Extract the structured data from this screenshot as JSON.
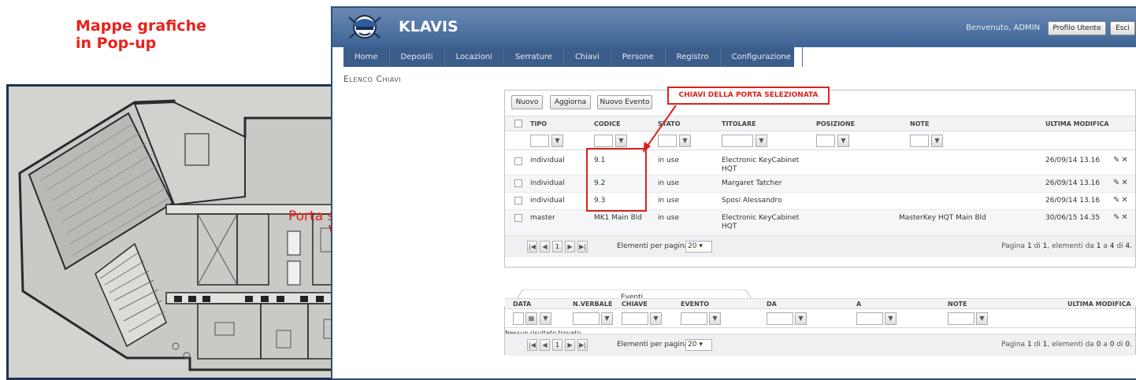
{
  "slide": {
    "title_line1": "Mappe grafiche",
    "title_line2": "in Pop-up"
  },
  "floorplan": {
    "label": "Porta selezionata",
    "marker_color": "#e1201a"
  },
  "app": {
    "brand": "KLAVIS",
    "welcome": "Benvenuto, ADMIN",
    "profile_button": "Profilo Utente",
    "logout_button": "Esci",
    "nav": [
      "Home",
      "Depositi",
      "Locazioni",
      "Serrature",
      "Chiavi",
      "Persone",
      "Registro",
      "Configurazione"
    ],
    "page_title": "Elenco Chiavi",
    "header_color": "#3d6394"
  },
  "keys_panel": {
    "buttons": {
      "new": "Nuovo",
      "refresh": "Aggiorna",
      "new_event": "Nuovo Evento"
    },
    "callout": "CHIAVI DELLA PORTA SELEZIONATA",
    "callout_color": "#d8231e",
    "columns": [
      "TIPO",
      "CODICE",
      "STATO",
      "TITOLARE",
      "POSIZIONE",
      "NOTE",
      "ULTIMA MODIFICA"
    ],
    "rows": [
      {
        "tipo": "individual",
        "codice": "9.1",
        "stato": "in use",
        "titolare": "Electronic KeyCabinet HQT",
        "posizione": "",
        "note": "",
        "modifica": "26/09/14 13.16"
      },
      {
        "tipo": "individual",
        "codice": "9.2",
        "stato": "in use",
        "titolare": "Margaret Tatcher",
        "posizione": "",
        "note": "",
        "modifica": "26/09/14 13.16"
      },
      {
        "tipo": "individual",
        "codice": "9.3",
        "stato": "in use",
        "titolare": "Sposi Alessandro",
        "posizione": "",
        "note": "",
        "modifica": "26/09/14 13.16"
      },
      {
        "tipo": "master",
        "codice": "MK1 Main Bld",
        "stato": "in use",
        "titolare": "Electronic KeyCabinet HQT",
        "posizione": "",
        "note": "MasterKey HQT Main Bld",
        "modifica": "30/06/15 14.35"
      }
    ],
    "pager": {
      "current_page": "1",
      "per_page_label": "Elementi per pagina:",
      "per_page": "20",
      "info_prefix": "Pagina",
      "page": "1",
      "of": "di",
      "pages": "1",
      "items_label": ", elementi da",
      "from": "1",
      "to_label": "a",
      "to": "4",
      "total_label": "di",
      "total": "4."
    }
  },
  "events_panel": {
    "tab": "Eventi",
    "columns": [
      "DATA",
      "N.VERBALE",
      "CHIAVE",
      "EVENTO",
      "DA",
      "A",
      "NOTE",
      "ULTIMA MODIFICA"
    ],
    "empty": "Nessun risultato trovato",
    "pager": {
      "current_page": "1",
      "per_page_label": "Elementi per pagina:",
      "per_page": "20",
      "info_prefix": "Pagina",
      "page": "1",
      "of": "di",
      "pages": "1",
      "items_label": ", elementi da",
      "from": "0",
      "to_label": "a",
      "to": "0",
      "total_label": "di",
      "total": "0."
    }
  }
}
